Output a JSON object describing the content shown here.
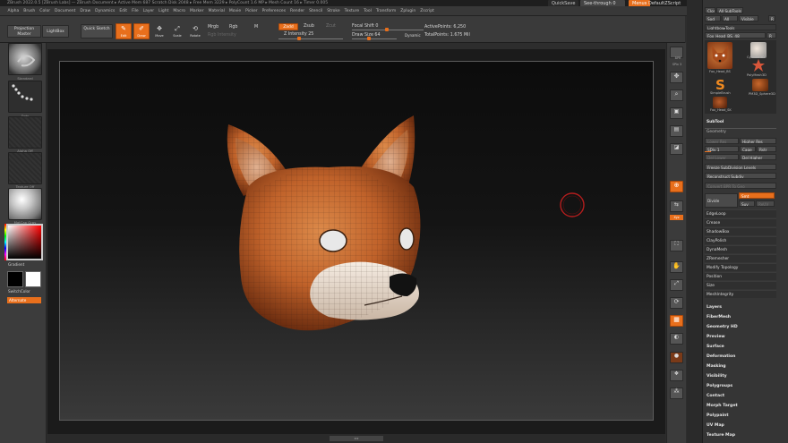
{
  "app": {
    "title": "ZBrush 2022.0.5 [ZBrush Labs] — ZBrush Document  ▸ Active Mem 687  Scratch Disk 2048  ▸ Free Mem 3229  ▸ PolyCount 1.6 MP  ▸ Mesh Count 16  ▸ Timer 0.005",
    "quicksave_label": "QuickSave",
    "see_through_label": "See-through 0",
    "menus_label": "Menus",
    "default_script_label": "DefaultZScript"
  },
  "menubar": [
    "Alpha",
    "Brush",
    "Color",
    "Document",
    "Draw",
    "Dynamics",
    "Edit",
    "File",
    "Layer",
    "Light",
    "Macro",
    "Marker",
    "Material",
    "Movie",
    "Picker",
    "Preferences",
    "Render",
    "Stencil",
    "Stroke",
    "Texture",
    "Tool",
    "Transform",
    "Zplugin",
    "Zscript"
  ],
  "toolbar": {
    "projection_master": "Projection Master",
    "lightbox": "LightBox",
    "quick_sketch": "Quick Sketch",
    "edit": "Edit",
    "draw": "Draw",
    "move": "Move",
    "scale": "Scale",
    "rotate": "Rotate",
    "mrgb": "Mrgb",
    "rgb": "Rgb",
    "m": "M",
    "rgb_intensity": "Rgb Intensity",
    "zadd": "Zadd",
    "zsub": "Zsub",
    "zcut": "Zcut",
    "z_intensity": "Z Intensity 25",
    "focal_shift": "Focal Shift 0",
    "draw_size": "Draw Size 64",
    "dynamic": "Dynamic",
    "active_points": "ActivePoints: 6,250",
    "total_points": "TotalPoints: 1.675 Mil"
  },
  "left_shelf": {
    "brush": "Standard",
    "stroke": "Dots",
    "alpha": "Alpha Off",
    "texture": "Texture Off",
    "material": "MatCap Gray",
    "gradient": "Gradient",
    "switch_color": "SwitchColor",
    "alternate": "Alternate"
  },
  "right_shelf": [
    "BPR",
    "SPix 3",
    "Scroll",
    "Zoom",
    "Actual",
    "AAHalf",
    "Persp",
    "Floor",
    "Local",
    "L.Sym",
    "Xyz",
    "Frame",
    "Move",
    "Scale",
    "Rotate",
    "Line Fill",
    "PolyF",
    "Transp",
    "Ghost",
    "Solo",
    "Xpose"
  ],
  "tray": {
    "clone_label": "Clone",
    "all_subtools_label": "All SubTools",
    "sod_label": "Sod",
    "all_label": "All",
    "visible_label": "Visible",
    "r_label": "R",
    "lightbox_tools": "Lightbox▸Tools",
    "current_tool": "Fox_Head_BS. 48",
    "tools": [
      "Fox_Head_BS",
      "Cylinder3D",
      "PolyMesh3D",
      "SimpleBrush",
      "PM3D_Sphere3D",
      "Fox_Head_SK"
    ],
    "subtool": "SubTool",
    "geometry": "Geometry",
    "lower_res": "Lower Res",
    "higher_res": "Higher Res",
    "sdiv": "SDiv 1",
    "cage": "Cage",
    "rstr": "Rstr",
    "del_lower": "Del Lower",
    "del_higher": "Del Higher",
    "freeze_subdiv": "Freeze SubDivision Levels",
    "reconstruct_subdiv": "Reconstruct Subdiv",
    "convert_bpr": "Convert BPR To Geo",
    "divide": "Divide",
    "smt": "Smt",
    "suv": "Suv",
    "reuv": "ReUV",
    "geometry_items": [
      "EdgeLoop",
      "Crease",
      "ShadowBox",
      "ClayPolish",
      "DynaMesh",
      "ZRemesher",
      "Modify Topology",
      "Position",
      "Size",
      "MeshIntegrity"
    ],
    "sections": [
      "Layers",
      "FiberMesh",
      "Geometry HD",
      "Preview",
      "Surface",
      "Deformation",
      "Masking",
      "Visibility",
      "Polygroups",
      "Contact",
      "Morph Target",
      "Polypaint",
      "UV Map",
      "Texture Map"
    ]
  },
  "colors": {
    "accent": "#e86f1c",
    "fox_fur": "#c0622a",
    "fox_light": "#f0e4d6",
    "brush_cursor": "#b51d1d"
  },
  "viewport": {
    "model": "fox head (polyframe)",
    "bottom_indicator": "◂ ▸"
  }
}
